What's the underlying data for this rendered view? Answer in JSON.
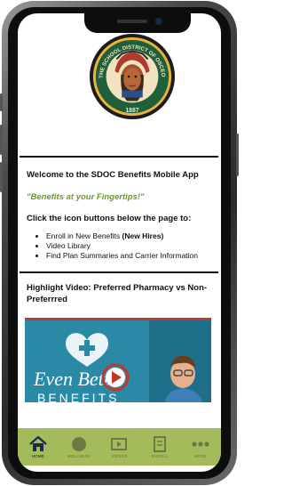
{
  "app": {
    "welcome": "Welcome to the SDOC Benefits Mobile App",
    "tagline": "\"Benefits at your Fingertips!\"",
    "intro": "Click the icon buttons below the page to:"
  },
  "seal": {
    "top_text": "THE SCHOOL DISTRICT OF OSCEOLA COUNTY, FL",
    "year": "1887"
  },
  "bullets": [
    {
      "text": "Enroll in New Benefits ",
      "bold": "(New Hires)"
    },
    {
      "text": "Video Library",
      "bold": ""
    },
    {
      "text": "Find Plan Summaries and Carrier Information",
      "bold": ""
    }
  ],
  "video": {
    "title": "Highlight Video: Preferred Pharmacy vs Non-Preferrred",
    "overlay_text": "Even Better",
    "overlay_text_2": "BENEFITS"
  },
  "tabbar": {
    "home": "HOME",
    "tab2": "WELLNESS",
    "tab3": "VIDEOS",
    "tab4": "ENROLL",
    "tab5": "MORE"
  },
  "colors": {
    "accent_green": "#6f9a1f",
    "tabbar_bg": "#a4bb5c",
    "video_bg": "#2a8aa6",
    "play_red": "#c0392b"
  }
}
